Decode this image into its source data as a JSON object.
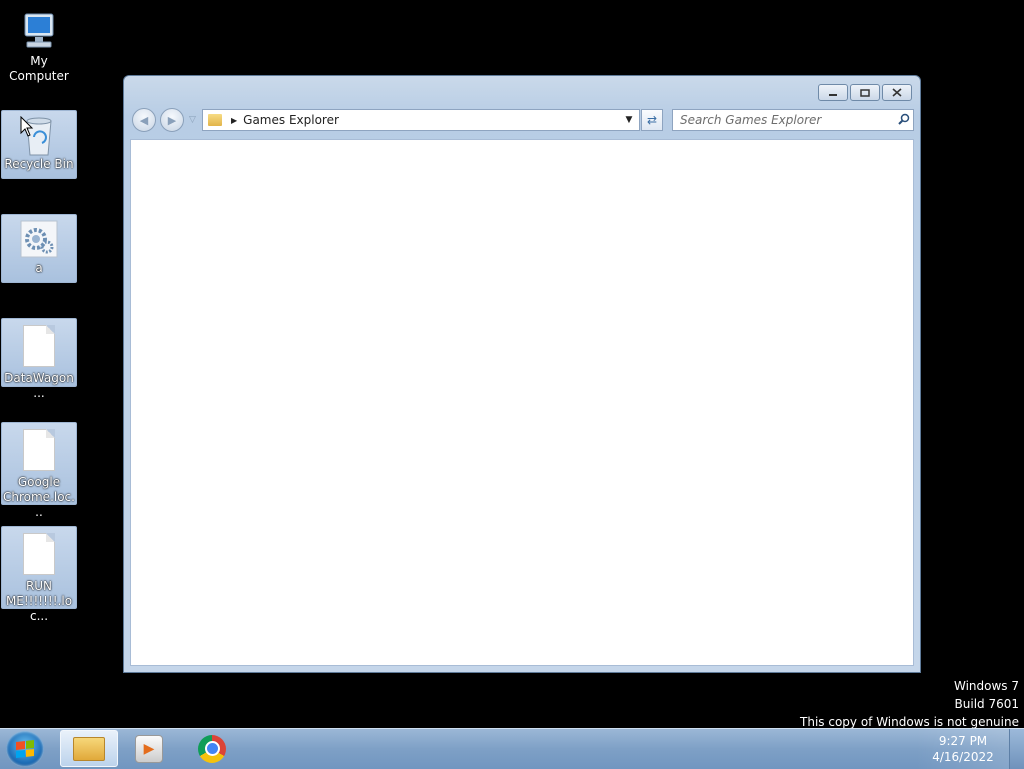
{
  "desktop": {
    "icons": [
      {
        "label": "My Computer",
        "icon": "my-computer-icon"
      },
      {
        "label": "Recycle Bin",
        "icon": "recycle-bin-icon"
      },
      {
        "label": "a",
        "icon": "settings-file-icon"
      },
      {
        "label": "DataWagon...",
        "icon": "document-icon"
      },
      {
        "label": "Google Chrome.loc...",
        "icon": "document-icon"
      },
      {
        "label": "RUN ME!!!!!!!.loc...",
        "icon": "document-icon"
      }
    ]
  },
  "window": {
    "title": "",
    "caption_buttons": {
      "minimize": "minimize-icon",
      "maximize": "maximize-icon",
      "close": "close-icon"
    },
    "address": "Games Explorer",
    "search_placeholder": "Search Games Explorer"
  },
  "watermark": {
    "line1": "Windows 7",
    "line2": "Build 7601",
    "line3": "This copy of Windows is not genuine"
  },
  "taskbar": {
    "pinned": [
      "windows-explorer-icon",
      "media-player-icon",
      "chrome-icon"
    ],
    "clock_time": "9:27 PM",
    "clock_date": "4/16/2022"
  }
}
